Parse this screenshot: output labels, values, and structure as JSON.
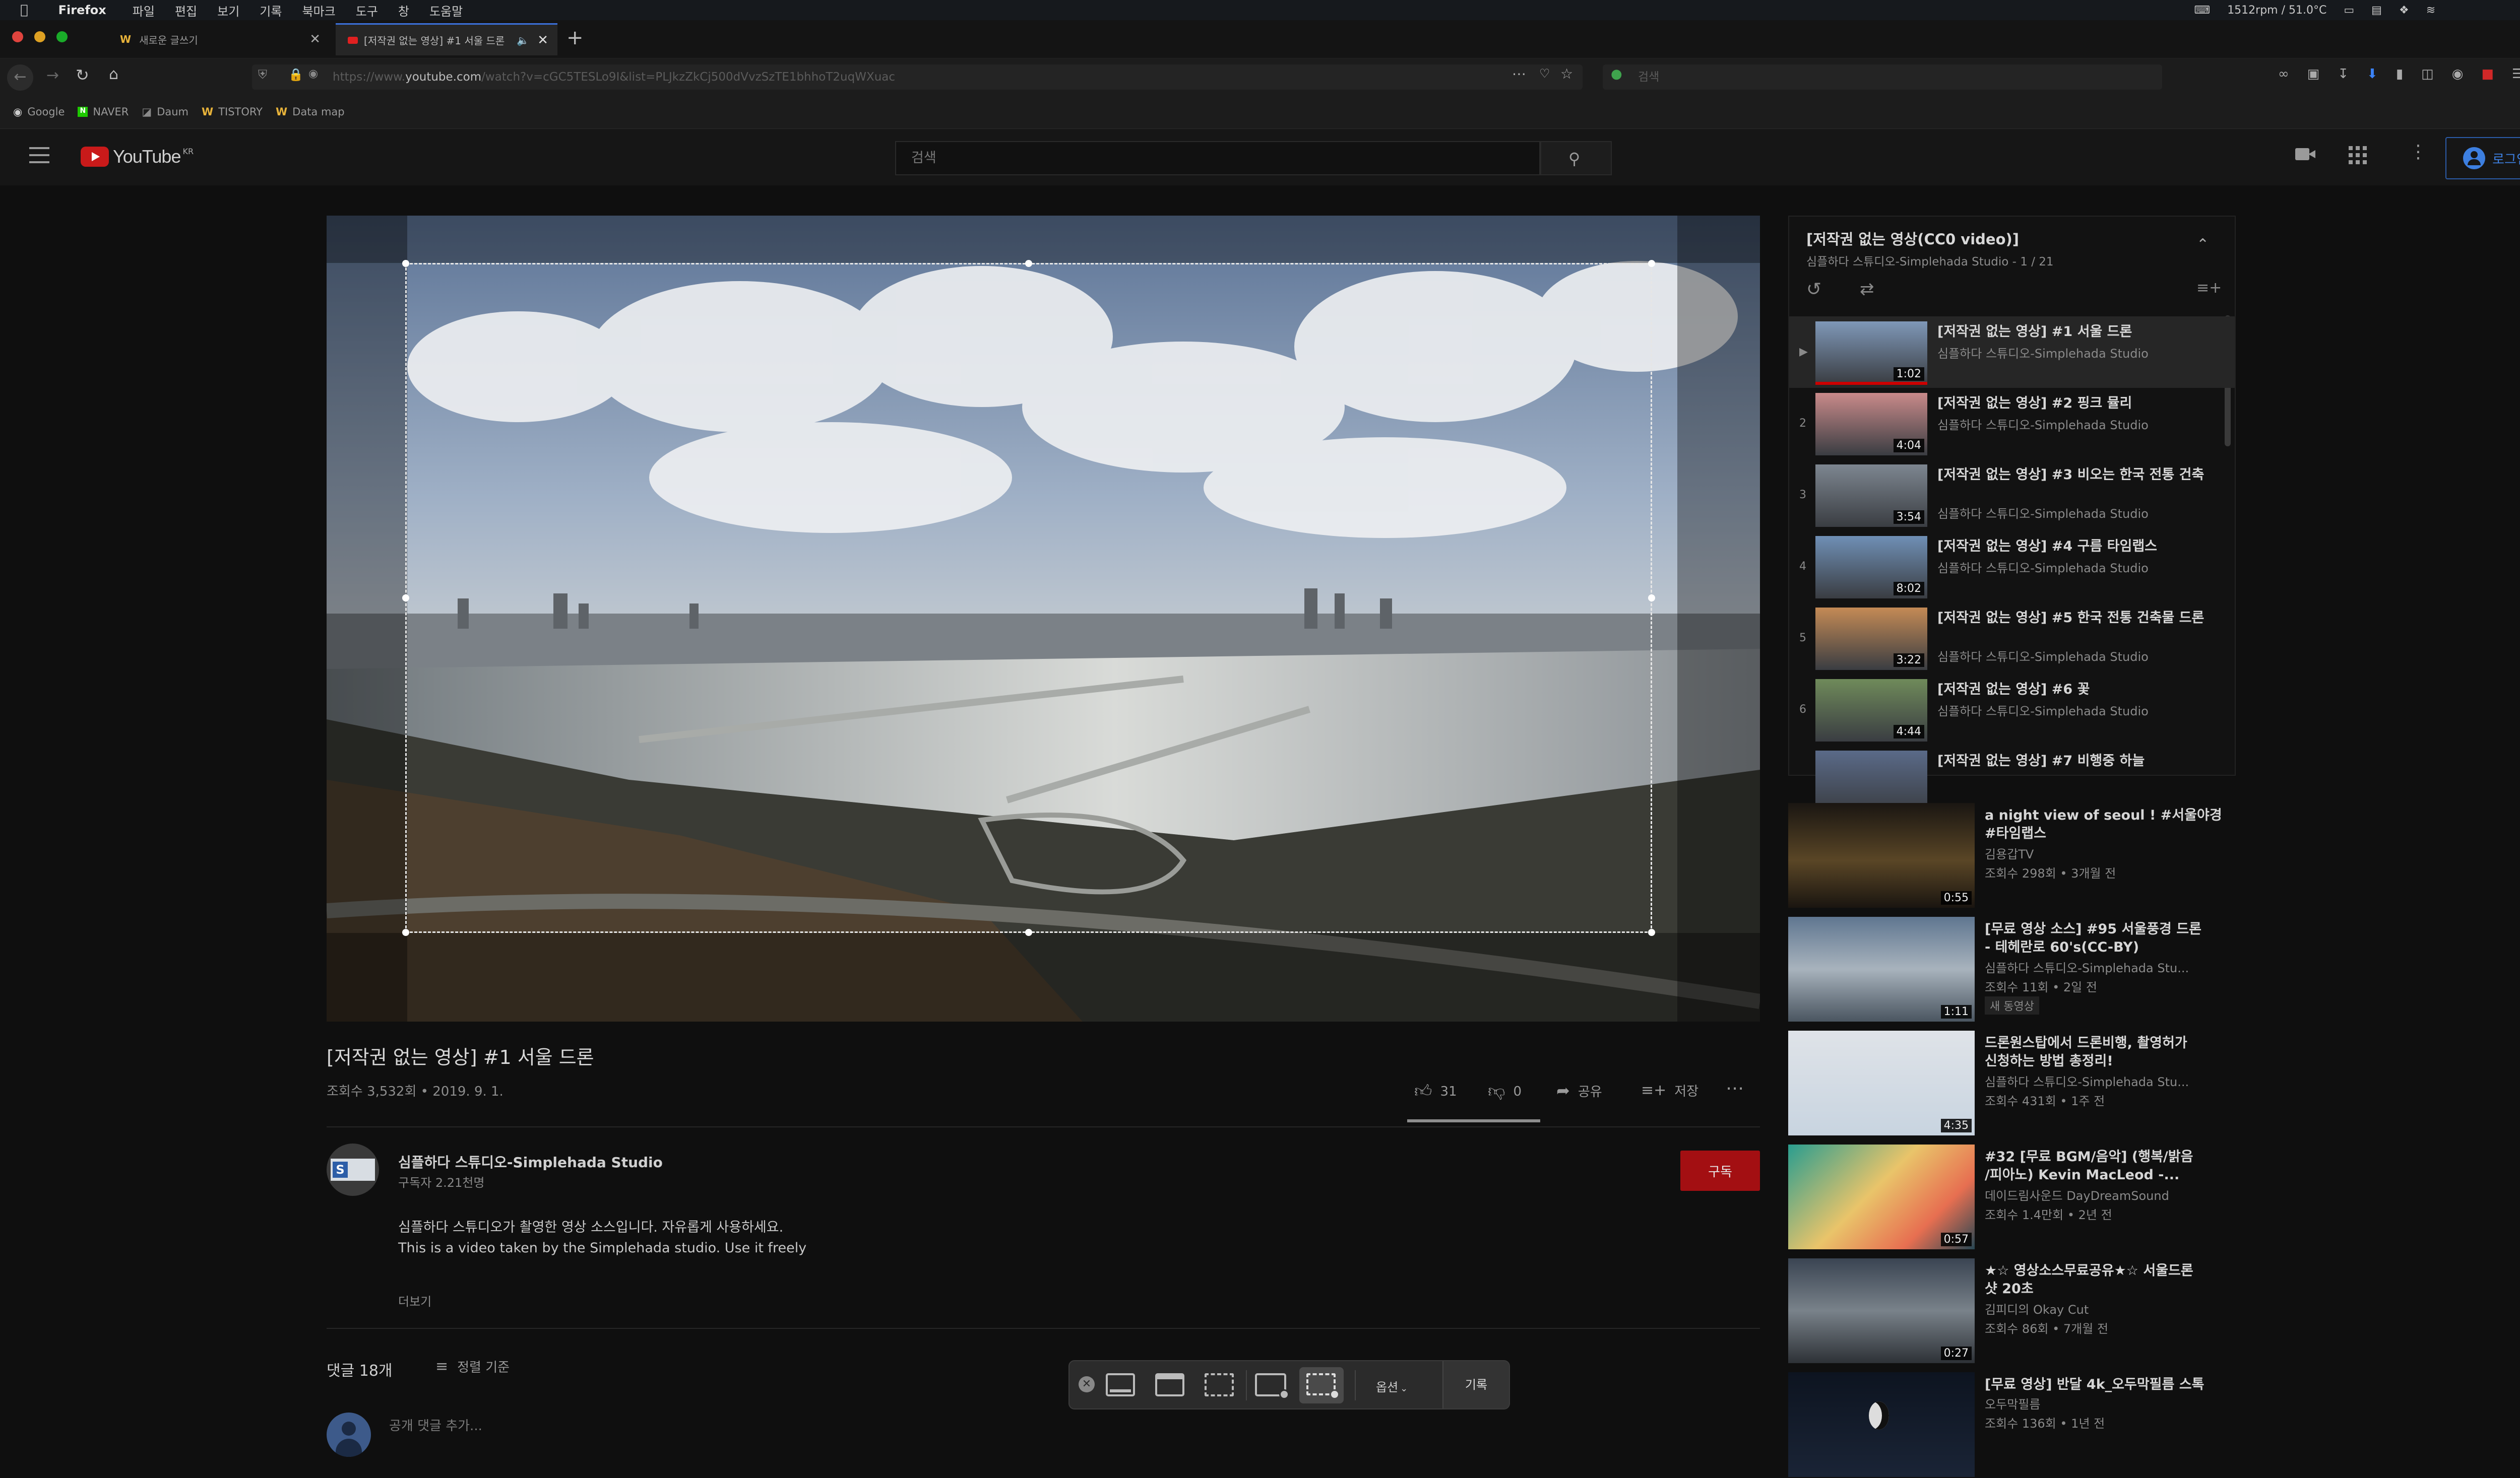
{
  "menubar": {
    "app": "Firefox",
    "items": [
      "파일",
      "편집",
      "보기",
      "기록",
      "북마크",
      "도구",
      "창",
      "도움말"
    ],
    "status_text": "1512rpm / 51.0°C"
  },
  "tabs": [
    {
      "label": "새로운 글쓰기"
    },
    {
      "label": "[저작권 없는 영상] #1 서울 드론"
    }
  ],
  "urlbar": {
    "prefix": "https://www.",
    "host": "youtube.com",
    "path": "/watch?v=cGC5TESLo9I&list=PLJkzZkCj500dVvzSzTE1bhhoT2uqWXuac"
  },
  "firefox_search": {
    "placeholder": "검색"
  },
  "bookmarks": [
    "Google",
    "NAVER",
    "Daum",
    "TISTORY",
    "Data map"
  ],
  "youtube": {
    "logo_text": "YouTube",
    "region": "KR",
    "search_placeholder": "검색",
    "login_label": "로그인"
  },
  "video": {
    "title": "[저작권 없는 영상] #1 서울 드론",
    "meta": "조회수 3,532회 • 2019. 9. 1.",
    "likes": "31",
    "dislikes": "0",
    "share_label": "공유",
    "save_label": "저장",
    "like_ratio": 1.0
  },
  "channel": {
    "name": "심플하다 스튜디오-Simplehada Studio",
    "subscribers": "구독자 2.21천명",
    "subscribe_label": "구독",
    "desc_line1": "심플하다 스튜디오가 촬영한 영상 소스입니다. 자유롭게 사용하세요.",
    "desc_line2": "This is a video taken by the Simplehada studio. Use it freely",
    "more_label": "더보기"
  },
  "comments": {
    "count_label": "댓글 18개",
    "sort_label": "정렬 기준",
    "add_placeholder": "공개 댓글 추가..."
  },
  "playlist": {
    "title": "[저작권 없는 영상(CC0 video)]",
    "subtitle": "심플하다 스튜디오-Simplehada Studio - 1 / 21",
    "items": [
      {
        "index": "▶",
        "title": "[저작권 없는 영상] #1 서울 드론",
        "channel": "심플하다 스튜디오-Simplehada Studio",
        "duration": "1:02",
        "active": true
      },
      {
        "index": "2",
        "title": "[저작권 없는 영상] #2 핑크 뮬리",
        "channel": "심플하다 스튜디오-Simplehada Studio",
        "duration": "4:04"
      },
      {
        "index": "3",
        "title": "[저작권 없는 영상] #3 비오는 한국 전통 건축",
        "channel": "심플하다 스튜디오-Simplehada Studio",
        "duration": "3:54"
      },
      {
        "index": "4",
        "title": "[저작권 없는 영상] #4 구름 타임랩스",
        "channel": "심플하다 스튜디오-Simplehada Studio",
        "duration": "8:02"
      },
      {
        "index": "5",
        "title": "[저작권 없는 영상] #5 한국 전통 건축물 드론",
        "channel": "심플하다 스튜디오-Simplehada Studio",
        "duration": "3:22"
      },
      {
        "index": "6",
        "title": "[저작권 없는 영상] #6 꽃",
        "channel": "심플하다 스튜디오-Simplehada Studio",
        "duration": "4:44"
      },
      {
        "index": "",
        "title": "[저작권 없는 영상] #7 비행중 하늘",
        "channel": "",
        "duration": ""
      }
    ]
  },
  "recommendations": [
    {
      "title1": "a night view of seoul ! #서울야경",
      "title2": "#타임랩스",
      "channel": "김용갑TV",
      "meta": "조회수 298회 • 3개월 전",
      "badge": "",
      "duration": "0:55"
    },
    {
      "title1": "[무료 영상 소스] #95 서울풍경 드론",
      "title2": "- 테헤란로 60's(CC-BY)",
      "channel": "심플하다 스튜디오-Simplehada Stu...",
      "meta": "조회수 11회 • 2일 전",
      "badge": "새 동영상",
      "duration": "1:11"
    },
    {
      "title1": "드론원스탑에서 드론비행, 촬영허가",
      "title2": "신청하는 방법 총정리!",
      "channel": "심플하다 스튜디오-Simplehada Stu...",
      "meta": "조회수 431회 • 1주 전",
      "badge": "",
      "duration": "4:35"
    },
    {
      "title1": "#32 [무료 BGM/음악] (행복/밝음",
      "title2": "/피아노) Kevin MacLeod -...",
      "channel": "데이드림사운드 DayDreamSound",
      "meta": "조회수 1.4만회 • 2년 전",
      "badge": "",
      "duration": "0:57"
    },
    {
      "title1": "★☆ 영상소스무료공유★☆ 서울드론",
      "title2": "샷 20초",
      "channel": "김피디의 Okay Cut",
      "meta": "조회수 86회 • 7개월 전",
      "badge": "",
      "duration": "0:27"
    },
    {
      "title1": "[무료 영상] 반달 4k_오두막필름 스톡",
      "title2": "",
      "channel": "오두막필름",
      "meta": "조회수 136회 • 1년 전",
      "badge": "",
      "duration": ""
    }
  ],
  "capture_toolbar": {
    "options_label": "옵션",
    "record_label": "기록"
  },
  "icons": {
    "accent": "#3b6fd8",
    "youtube_red": "#ff0000",
    "subscribe_red": "#a30f12"
  }
}
